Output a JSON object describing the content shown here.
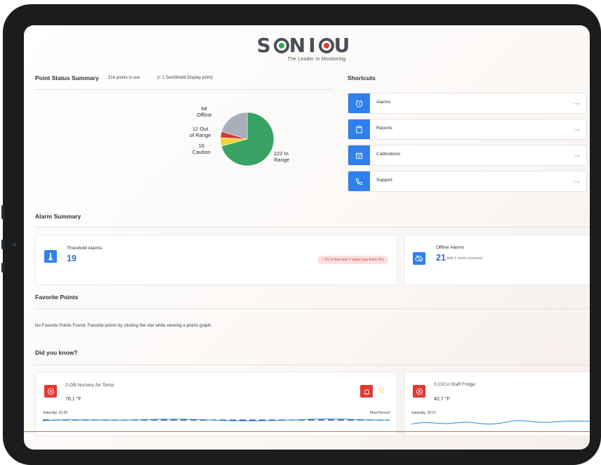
{
  "brand": {
    "word_before": "S",
    "word_after_o": "N",
    "word_i": "I",
    "word_c": "C",
    "word_u": "U",
    "tagline": "The Leader In Monitoring",
    "dot_colors": [
      "#2eaa5e",
      "#f2c400",
      "#e53935"
    ]
  },
  "point_status": {
    "title": "Point Status Summary",
    "points_in_use": "314 points in use",
    "display_note": "(+ 1 SoniShield Display point)"
  },
  "chart_data": {
    "type": "pie",
    "slices": [
      {
        "label_line1": "222 In",
        "label_line2": "Range",
        "value": 222,
        "color": "#3aa364"
      },
      {
        "label_line1": "16",
        "label_line2": "Caution",
        "value": 16,
        "color": "#f0d43c"
      },
      {
        "label_line1": "12 Out",
        "label_line2": "of Range",
        "value": 12,
        "color": "#d23b36"
      },
      {
        "label_line1": "64",
        "label_line2": "Offline",
        "value": 64,
        "color": "#a7afbb"
      }
    ]
  },
  "shortcuts": {
    "title": "Shortcuts",
    "items": [
      {
        "label": "Alarms",
        "icon": "alarm-clock-icon"
      },
      {
        "label": "Reports",
        "icon": "clipboard-icon"
      },
      {
        "label": "Calibrations",
        "icon": "calendar-check-icon"
      },
      {
        "label": "Support",
        "icon": "phone-icon"
      }
    ],
    "arrow": "→"
  },
  "alarm_summary": {
    "title": "Alarm Summary",
    "threshold": {
      "label": "Threshold Alarms",
      "count": "19",
      "trend": "↑ 51 in the last 7 days (up from 41)"
    },
    "offline": {
      "label": "Offline Alarms",
      "count": "21",
      "snoozed": "with 1 more snoozed"
    }
  },
  "favorites": {
    "title": "Favorite Points",
    "empty_message": "No Favorite Points Found. Favorite points by clicking the star while viewing a points graph."
  },
  "did_you_know": {
    "title": "Did you know?",
    "cards": [
      {
        "name": "2.OB.Nursery Air Temp",
        "value": "78.1 °F",
        "time": "Saturday, 20:28",
        "recent": "Most Recent"
      },
      {
        "name": "3.CICU.Staff Fridge",
        "value": "42.7 °F",
        "time": "Saturday, 20:27"
      }
    ]
  },
  "colors": {
    "accent": "#2f80ed",
    "alarm_red": "#e53935",
    "star": "#f2c400"
  }
}
